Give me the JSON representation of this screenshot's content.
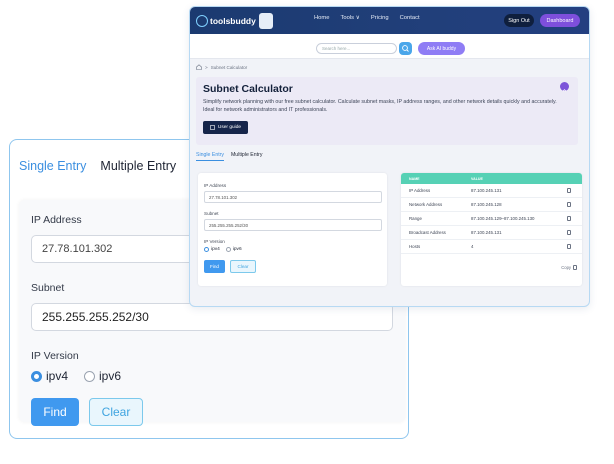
{
  "back_card": {
    "tabs": [
      "Single Entry",
      "Multiple Entry"
    ],
    "ip_label": "IP Address",
    "ip_value": "27.78.101.302",
    "subnet_label": "Subnet",
    "subnet_value": "255.255.255.252/30",
    "ipversion_label": "IP Version",
    "ipv4": "ipv4",
    "ipv6": "ipv6",
    "find": "Find",
    "clear": "Clear"
  },
  "nav": {
    "brand": "toolsbuddy",
    "links": [
      "Home",
      "Tools ∨",
      "Pricing",
      "Contact"
    ],
    "signout": "Sign Out",
    "dashboard": "Dashboard"
  },
  "search": {
    "placeholder": "Search here...",
    "ai": "Ask AI buddy"
  },
  "breadcrumb": "Subnet Calculator",
  "hero": {
    "title": "Subnet Calculator",
    "desc": "Simplify network planning with our free subnet calculator. Calculate subnet masks, IP address ranges, and other network details quickly and accurately. Ideal for network administrators and IT professionals.",
    "guide": "User guide"
  },
  "front": {
    "tabs": [
      "Single Entry",
      "Multiple Entry"
    ],
    "ip_label": "IP Address",
    "ip_value": "27.78.101.302",
    "subnet_label": "Subnet",
    "subnet_value": "255.255.255.252/30",
    "ipversion_label": "IP Version",
    "ipv4": "ipv4",
    "ipv6": "ipv6",
    "find": "Find",
    "clear": "Clear"
  },
  "results": {
    "head": [
      "NAME",
      "VALUE"
    ],
    "rows": [
      {
        "name": "IP Address",
        "value": "87.100.245.131"
      },
      {
        "name": "Network Address",
        "value": "87.100.245.128"
      },
      {
        "name": "Range",
        "value": "87.100.245.129–87.100.245.130"
      },
      {
        "name": "Broadcast Address",
        "value": "87.100.245.131"
      },
      {
        "name": "Hosts",
        "value": "4"
      }
    ],
    "copy": "Copy"
  }
}
